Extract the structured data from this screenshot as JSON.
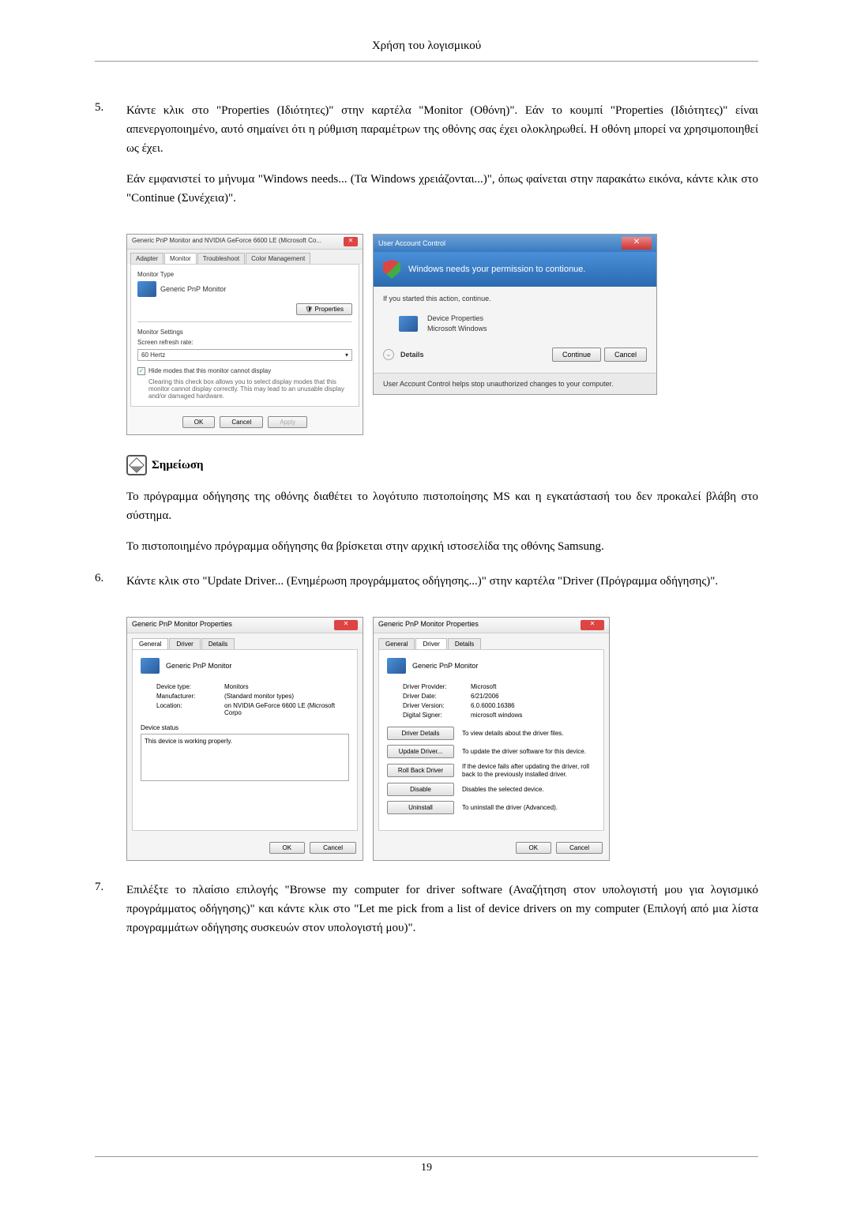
{
  "header": "Χρήση του λογισμικού",
  "item5": {
    "number": "5.",
    "para1": "Κάντε κλικ στο \"Properties (Ιδιότητες)\" στην καρτέλα \"Monitor (Οθόνη)\". Εάν το κουμπί \"Properties (Ιδιότητες)\" είναι απενεργοποιημένο, αυτό σημαίνει ότι η ρύθμιση παραμέτρων της οθόνης σας έχει ολοκληρωθεί. Η οθόνη μπορεί να χρησιμοποιηθεί ως έχει.",
    "para2": "Εάν εμφανιστεί το μήνυμα \"Windows needs... (Τα Windows χρειάζονται...)\", όπως φαίνεται στην παρακάτω εικόνα, κάντε κλικ στο \"Continue (Συνέχεια)\"."
  },
  "dialog1": {
    "title": "Generic PnP Monitor and NVIDIA GeForce 6600 LE (Microsoft Co...",
    "tabs": [
      "Adapter",
      "Monitor",
      "Troubleshoot",
      "Color Management"
    ],
    "monitor_type_label": "Monitor Type",
    "monitor_name": "Generic PnP Monitor",
    "properties_btn": "Properties",
    "settings_label": "Monitor Settings",
    "refresh_label": "Screen refresh rate:",
    "refresh_value": "60 Hertz",
    "hide_modes": "Hide modes that this monitor cannot display",
    "hide_desc": "Clearing this check box allows you to select display modes that this monitor cannot display correctly. This may lead to an unusable display and/or damaged hardware.",
    "ok": "OK",
    "cancel": "Cancel",
    "apply": "Apply"
  },
  "uac": {
    "title": "User Account Control",
    "banner": "Windows needs your permission to contionue.",
    "body_text": "If you started this action, continue.",
    "app_name": "Device Properties",
    "app_publisher": "Microsoft Windows",
    "details": "Details",
    "continue": "Continue",
    "cancel": "Cancel",
    "footer": "User Account Control helps stop unauthorized changes to your computer."
  },
  "note": {
    "label": "Σημείωση",
    "para1": "Το πρόγραμμα οδήγησης της οθόνης διαθέτει το λογότυπο πιστοποίησης MS και η εγκατάστασή του δεν προκαλεί βλάβη στο σύστημα.",
    "para2": "Το πιστοποιημένο πρόγραμμα οδήγησης θα βρίσκεται στην αρχική ιστοσελίδα της οθόνης Samsung."
  },
  "item6": {
    "number": "6.",
    "para1": "Κάντε κλικ στο \"Update Driver... (Ενημέρωση προγράμματος οδήγησης...)\" στην καρτέλα \"Driver (Πρόγραμμα οδήγησης)\"."
  },
  "props1": {
    "title": "Generic PnP Monitor Properties",
    "tabs": [
      "General",
      "Driver",
      "Details"
    ],
    "monitor_name": "Generic PnP Monitor",
    "device_type_label": "Device type:",
    "device_type": "Monitors",
    "manufacturer_label": "Manufacturer:",
    "manufacturer": "(Standard monitor types)",
    "location_label": "Location:",
    "location": "on NVIDIA GeForce 6600 LE (Microsoft Corpo",
    "status_label": "Device status",
    "status_text": "This device is working properly.",
    "ok": "OK",
    "cancel": "Cancel"
  },
  "props2": {
    "title": "Generic PnP Monitor Properties",
    "tabs": [
      "General",
      "Driver",
      "Details"
    ],
    "monitor_name": "Generic PnP Monitor",
    "provider_label": "Driver Provider:",
    "provider": "Microsoft",
    "date_label": "Driver Date:",
    "date": "6/21/2006",
    "version_label": "Driver Version:",
    "version": "6.0.6000.16386",
    "signer_label": "Digital Signer:",
    "signer": "microsoft windows",
    "btn_details": "Driver Details",
    "btn_details_desc": "To view details about the driver files.",
    "btn_update": "Update Driver...",
    "btn_update_desc": "To update the driver software for this device.",
    "btn_rollback": "Roll Back Driver",
    "btn_rollback_desc": "If the device fails after updating the driver, roll back to the previously installed driver.",
    "btn_disable": "Disable",
    "btn_disable_desc": "Disables the selected device.",
    "btn_uninstall": "Uninstall",
    "btn_uninstall_desc": "To uninstall the driver (Advanced).",
    "ok": "OK",
    "cancel": "Cancel"
  },
  "item7": {
    "number": "7.",
    "para1": "Επιλέξτε το πλαίσιο επιλογής \"Browse my computer for driver software (Αναζήτηση στον υπολογιστή μου για λογισμικό προγράμματος οδήγησης)\" και κάντε κλικ στο \"Let me pick from a list of device drivers on my computer (Επιλογή από μια λίστα προγραμμάτων οδήγησης συσκευών στον υπολογιστή μου)\"."
  },
  "page_number": "19"
}
